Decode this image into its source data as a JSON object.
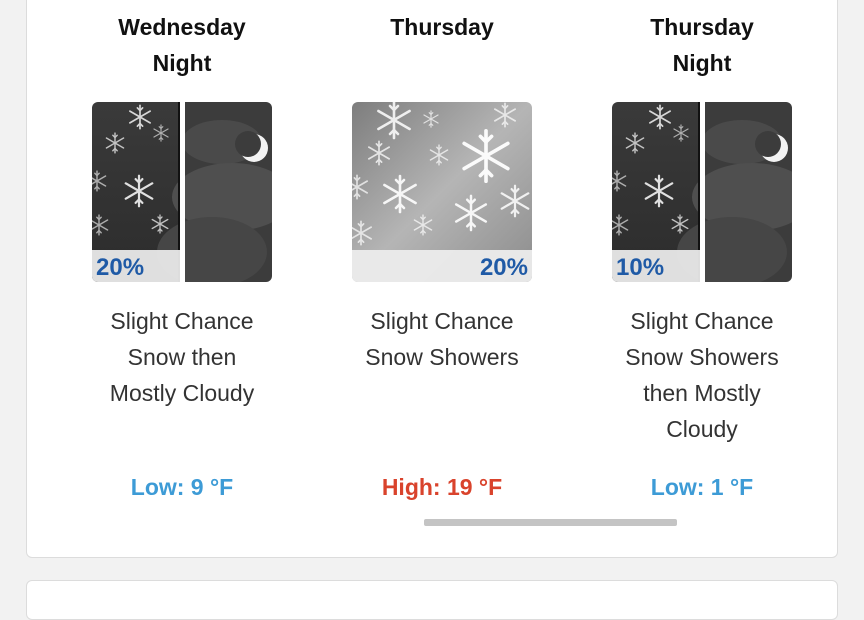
{
  "periods": [
    {
      "name": "Wednesday\nNight",
      "chance": "20%",
      "description": "Slight Chance\nSnow then\nMostly Cloudy",
      "temperature": "Low: 9 °F",
      "temp_kind": "low",
      "icon": "snow-then-cloudy-night-icon"
    },
    {
      "name": "Thursday",
      "chance": "20%",
      "description": "Slight Chance\nSnow Showers",
      "temperature": "High: 19 °F",
      "temp_kind": "high",
      "icon": "snow-showers-icon"
    },
    {
      "name": "Thursday\nNight",
      "chance": "10%",
      "description": "Slight Chance\nSnow Showers\nthen Mostly\nCloudy",
      "temperature": "Low: 1 °F",
      "temp_kind": "low",
      "icon": "snow-then-cloudy-night-icon"
    }
  ],
  "colors": {
    "low_temp": "#3d9bd6",
    "high_temp": "#d9432c",
    "chance_text": "#1f5aa6"
  }
}
